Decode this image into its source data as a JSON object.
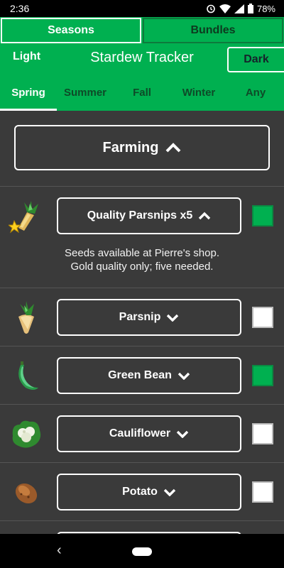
{
  "status": {
    "time": "2:36",
    "battery": "78%"
  },
  "tabs": [
    {
      "label": "Seasons",
      "active": true
    },
    {
      "label": "Bundles",
      "active": false
    }
  ],
  "header": {
    "light_label": "Light",
    "title": "Stardew Tracker",
    "dark_label": "Dark"
  },
  "seasons": [
    "Spring",
    "Summer",
    "Fall",
    "Winter",
    "Any"
  ],
  "active_season": "Spring",
  "category": {
    "label": "Farming",
    "expanded": true
  },
  "items": [
    {
      "name": "Quality Parsnips x5",
      "icon": "quality-parsnip-icon",
      "checked": true,
      "expanded": true,
      "details": [
        "Seeds available at Pierre's shop.",
        "Gold quality only; five needed."
      ]
    },
    {
      "name": "Parsnip",
      "icon": "parsnip-icon",
      "checked": false,
      "expanded": false
    },
    {
      "name": "Green Bean",
      "icon": "green-bean-icon",
      "checked": true,
      "expanded": false
    },
    {
      "name": "Cauliflower",
      "icon": "cauliflower-icon",
      "checked": false,
      "expanded": false
    },
    {
      "name": "Potato",
      "icon": "potato-icon",
      "checked": false,
      "expanded": false
    }
  ],
  "colors": {
    "accent": "#00b050",
    "background": "#3a3a3a"
  }
}
